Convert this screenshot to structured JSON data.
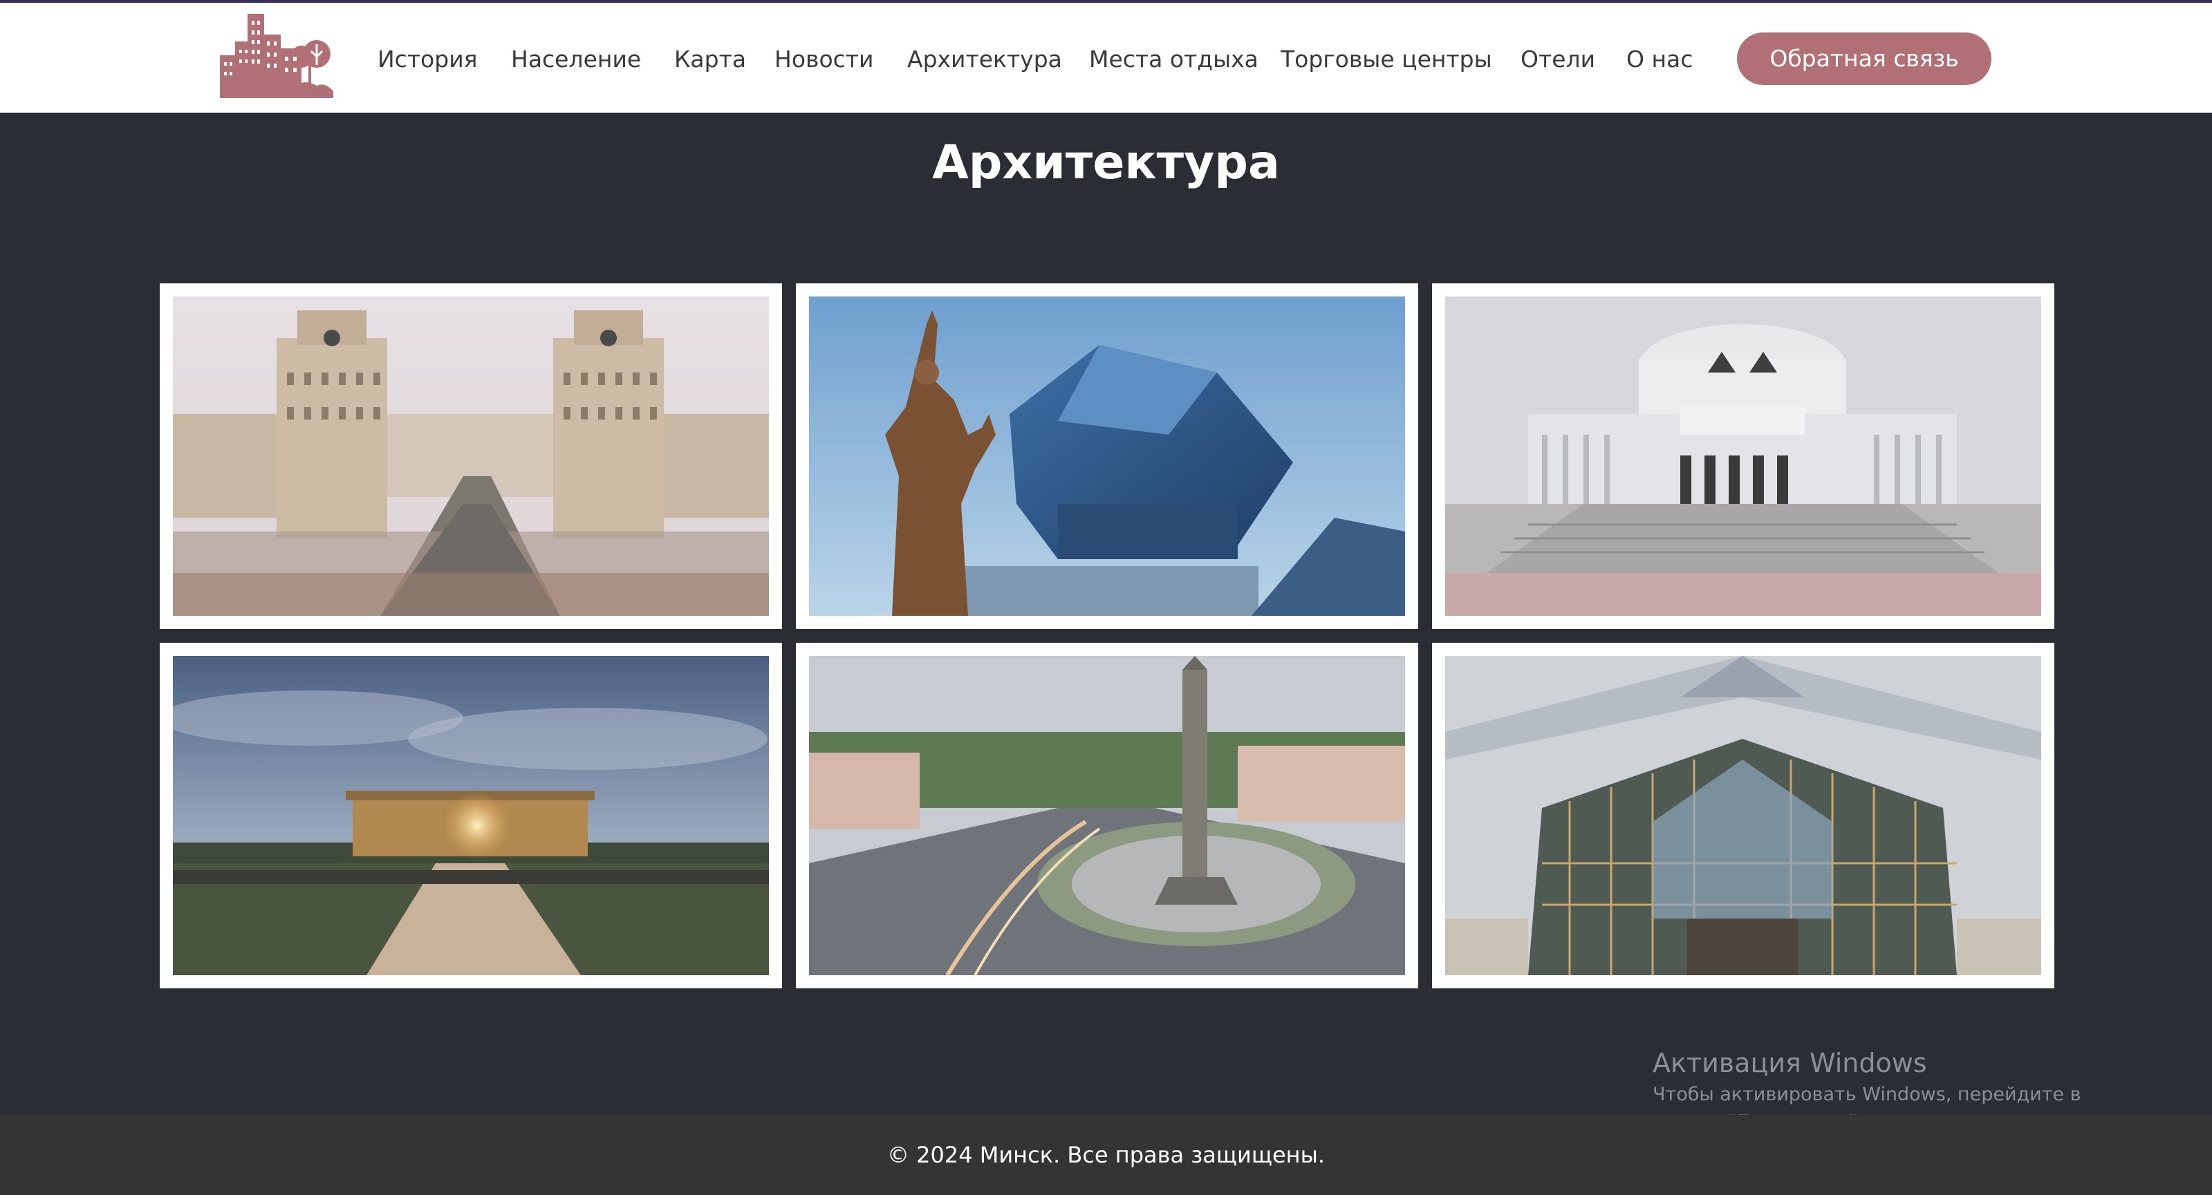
{
  "nav": {
    "items": [
      "История",
      "Население",
      "Карта",
      "Новости",
      "Архитектура",
      "Места отдыха",
      "Торговые центры",
      "Отели",
      "О нас"
    ],
    "feedback_label": "Обратная связь"
  },
  "page": {
    "title": "Архитектура"
  },
  "gallery": [
    {
      "name": "station-gates-photo"
    },
    {
      "name": "national-library-photo"
    },
    {
      "name": "opera-theatre-photo"
    },
    {
      "name": "independence-palace-photo"
    },
    {
      "name": "victory-square-photo"
    },
    {
      "name": "railway-station-photo"
    }
  ],
  "activation": {
    "title": "Активация Windows",
    "text": "Чтобы активировать Windows, перейдите в раздел \"Параметры\"."
  },
  "footer": {
    "text": "© 2024 Минск. Все права защищены."
  },
  "colors": {
    "accent": "#b07076",
    "header_bg": "#ffffff",
    "page_bg": "#2b2d34",
    "footer_bg": "#343434"
  }
}
